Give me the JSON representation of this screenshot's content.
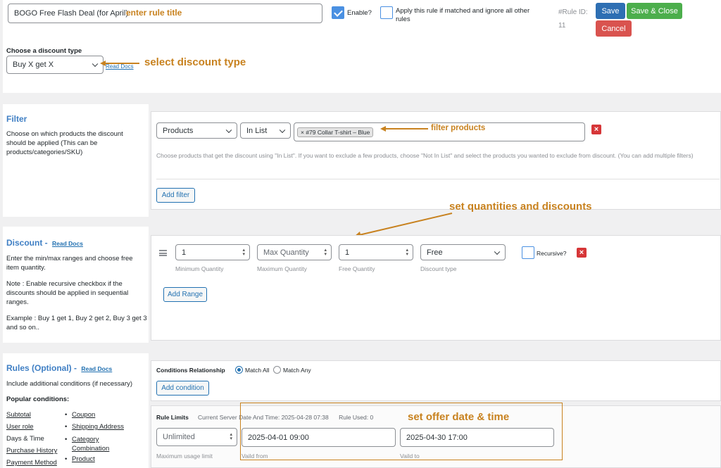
{
  "top": {
    "title_value": "BOGO Free Flash Deal (for April)",
    "enable_label": "Enable?",
    "apply_label": "Apply this rule if matched and ignore all other rules",
    "rule_id_label": "#Rule ID:",
    "rule_id_value": "11",
    "save_label": "Save",
    "save_close_label": "Save & Close",
    "cancel_label": "Cancel",
    "discount_type_label": "Choose a discount type",
    "discount_type_value": "Buy X get X",
    "read_docs": "Read Docs"
  },
  "annotations": {
    "rule_title": "enter rule title",
    "discount_type": "select discount type",
    "filter_products": "filter products",
    "quantities": "set quantities and discounts",
    "offer_date": "set offer date & time"
  },
  "filter": {
    "title": "Filter",
    "description": "Choose on which products the discount should be applied (This can be products/categories/SKU)",
    "type_value": "Products",
    "operator_value": "In List",
    "chip_label": "× #79 Collar T-shirt – Blue",
    "help": "Choose products that get the discount using \"In List\". If you want to exclude a few products, choose \"Not In List\" and select the products you wanted to exclude from discount. (You can add multiple filters)",
    "add_filter": "Add filter"
  },
  "discount": {
    "title": "Discount -",
    "read_docs": "Read Docs",
    "desc1": "Enter the min/max ranges and choose free item quantity.",
    "desc2": "Note : Enable recursive checkbox if the discounts should be applied in sequential ranges.",
    "desc3": "Example : Buy 1 get 1, Buy 2 get 2, Buy 3 get 3 and so on..",
    "min_value": "1",
    "min_label": "Minimum Quantity",
    "max_placeholder": "Max Quantity",
    "max_label": "Maximum Quantity",
    "free_value": "1",
    "free_label": "Free Quantity",
    "type_value": "Free",
    "type_label": "Discount type",
    "recursive_label": "Recursive?",
    "add_range": "Add Range"
  },
  "rules": {
    "title": "Rules (Optional) -",
    "read_docs": "Read Docs",
    "desc": "Include additional conditions (if necessary)",
    "popular": "Popular conditions:",
    "left_links": [
      "Subtotal",
      "User role",
      "Days & Time",
      "Purchase History",
      "Payment Method"
    ],
    "right_links": [
      "Coupon",
      "Shipping Address",
      "Category Combination",
      "Product"
    ],
    "conditions_relationship": "Conditions Relationship",
    "match_all": "Match All",
    "match_any": "Match Any",
    "add_condition": "Add condition",
    "rule_limits": "Rule Limits",
    "server_time": "Current Server Date And Time: 2025-04-28 07:38",
    "rule_used": "Rule Used: 0",
    "limit_value": "Unlimited",
    "limit_label": "Maximum usage limit",
    "from_value": "2025-04-01 09:00",
    "from_label": "Vaild from",
    "to_value": "2025-04-30 17:00",
    "to_label": "Vaild to"
  },
  "colors": {
    "primary": "#2271b1",
    "success": "#4cae4c",
    "danger": "#d9534f",
    "annotation": "#c8821f",
    "section_title": "#3f7fc4"
  }
}
